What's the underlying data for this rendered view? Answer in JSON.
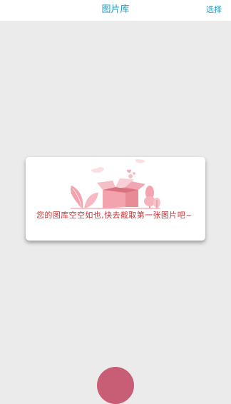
{
  "nav": {
    "title": "图片库",
    "select_label": "选择"
  },
  "empty_state": {
    "message": "您的图库空空如也,快去截取第一张图片吧~",
    "illustration_icon": "empty-box-icon"
  },
  "colors": {
    "accent": "#1a9fc4",
    "message_text": "#c83234",
    "illustration_pink": "#f2a3ad",
    "fab": "#c85d76",
    "background": "#ebebeb"
  }
}
